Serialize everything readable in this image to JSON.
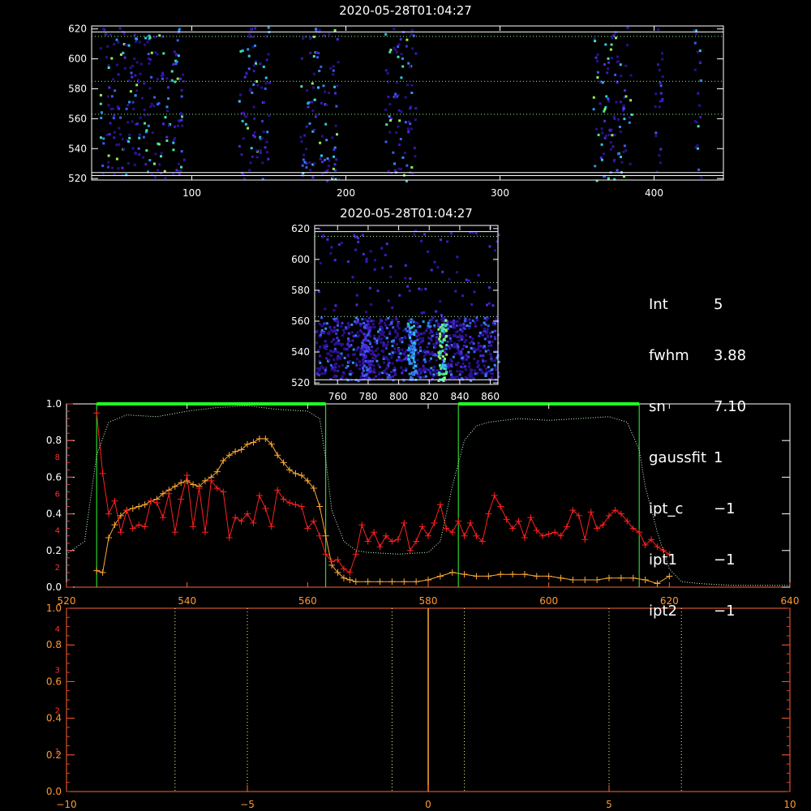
{
  "panel1": {
    "title": "2020-05-28T01:04:27",
    "x_ticks": [
      "100",
      "200",
      "300",
      "400"
    ],
    "y_ticks": [
      "520",
      "540",
      "560",
      "580",
      "600",
      "620"
    ]
  },
  "panel2": {
    "title": "2020-05-28T01:04:27",
    "x_ticks": [
      "760",
      "780",
      "800",
      "820",
      "840",
      "860"
    ],
    "y_ticks": [
      "520",
      "540",
      "560",
      "580",
      "600",
      "620"
    ]
  },
  "info": [
    {
      "key": "Int",
      "value": "5"
    },
    {
      "key": "fwhm",
      "value": "3.88"
    },
    {
      "key": "sn",
      "value": "7.10"
    },
    {
      "key": "gaussfit",
      "value": "1"
    },
    {
      "key": "ipt_c",
      "value": "−1"
    },
    {
      "key": "ipt1",
      "value": "−1"
    },
    {
      "key": "ipt2",
      "value": "−1"
    }
  ],
  "panel3": {
    "x_ticks": [
      "520",
      "540",
      "560",
      "580",
      "600",
      "620",
      "640"
    ],
    "y_ticks": [
      "0.0",
      "0.2",
      "0.4",
      "0.6",
      "0.8",
      "1.0"
    ],
    "y2_ticks": [
      "2",
      "4",
      "6",
      "8"
    ]
  },
  "panel4": {
    "x_ticks": [
      "−10",
      "−5",
      "0",
      "5",
      "10"
    ],
    "y_ticks": [
      "0.0",
      "0.2",
      "0.4",
      "0.6",
      "0.8",
      "1.0"
    ],
    "y2_ticks": [
      "1",
      "2",
      "3",
      "4"
    ]
  },
  "chart_data": [
    {
      "type": "heatmap",
      "title": "2020-05-28T01:04:27",
      "xlim": [
        35,
        445
      ],
      "ylim": [
        519,
        622
      ],
      "bands_x": [
        [
          40,
          95
        ],
        [
          130,
          150
        ],
        [
          170,
          195
        ],
        [
          225,
          245
        ],
        [
          360,
          385
        ],
        [
          400,
          405
        ],
        [
          425,
          430
        ]
      ],
      "hlines_y": [
        524,
        563,
        585,
        615
      ]
    },
    {
      "type": "heatmap",
      "title": "2020-05-28T01:04:27",
      "xlim": [
        745,
        865
      ],
      "ylim": [
        519,
        622
      ],
      "hlines_y": [
        563,
        585,
        615
      ]
    },
    {
      "type": "line",
      "xlim": [
        520,
        640
      ],
      "ylim": [
        0,
        1.0
      ],
      "boxes": [
        {
          "x0": 525,
          "x1": 563,
          "y": 1.0
        },
        {
          "x0": 585,
          "x1": 615,
          "y": 1.0
        }
      ],
      "series": [
        {
          "color": "#ffaa33",
          "x": [
            525,
            526,
            527,
            528,
            529,
            530,
            531,
            532,
            533,
            534,
            535,
            536,
            537,
            538,
            539,
            540,
            541,
            542,
            543,
            544,
            545,
            546,
            547,
            548,
            549,
            550,
            551,
            552,
            553,
            554,
            555,
            556,
            557,
            558,
            559,
            560,
            561,
            562,
            563,
            564,
            565,
            566,
            567,
            568,
            570,
            572,
            574,
            576,
            578,
            580,
            582,
            584,
            586,
            588,
            590,
            592,
            594,
            596,
            598,
            600,
            602,
            604,
            606,
            608,
            610,
            612,
            614,
            616,
            618,
            620
          ],
          "y": [
            0.09,
            0.08,
            0.27,
            0.34,
            0.39,
            0.42,
            0.43,
            0.44,
            0.45,
            0.47,
            0.48,
            0.51,
            0.53,
            0.55,
            0.57,
            0.58,
            0.56,
            0.55,
            0.58,
            0.6,
            0.63,
            0.69,
            0.72,
            0.74,
            0.75,
            0.78,
            0.79,
            0.81,
            0.81,
            0.78,
            0.72,
            0.68,
            0.64,
            0.62,
            0.61,
            0.58,
            0.54,
            0.44,
            0.28,
            0.12,
            0.08,
            0.05,
            0.04,
            0.03,
            0.03,
            0.03,
            0.03,
            0.03,
            0.03,
            0.04,
            0.06,
            0.08,
            0.07,
            0.06,
            0.06,
            0.07,
            0.07,
            0.07,
            0.06,
            0.06,
            0.05,
            0.04,
            0.04,
            0.04,
            0.05,
            0.05,
            0.05,
            0.04,
            0.02,
            0.06
          ]
        },
        {
          "color": "#ff2020",
          "x": [
            525,
            526,
            527,
            528,
            529,
            530,
            531,
            532,
            533,
            534,
            535,
            536,
            537,
            538,
            539,
            540,
            541,
            542,
            543,
            544,
            545,
            546,
            547,
            548,
            549,
            550,
            551,
            552,
            553,
            554,
            555,
            556,
            557,
            558,
            559,
            560,
            561,
            562,
            563,
            564,
            565,
            566,
            567,
            568,
            569,
            570,
            571,
            572,
            573,
            574,
            575,
            576,
            577,
            578,
            579,
            580,
            581,
            582,
            583,
            584,
            585,
            586,
            587,
            588,
            589,
            590,
            591,
            592,
            593,
            594,
            595,
            596,
            597,
            598,
            599,
            600,
            601,
            602,
            603,
            604,
            605,
            606,
            607,
            608,
            609,
            610,
            611,
            612,
            613,
            614,
            615,
            616,
            617,
            618,
            619,
            620
          ],
          "y": [
            0.95,
            0.62,
            0.4,
            0.47,
            0.3,
            0.42,
            0.32,
            0.34,
            0.33,
            0.47,
            0.46,
            0.38,
            0.51,
            0.3,
            0.48,
            0.61,
            0.33,
            0.54,
            0.3,
            0.58,
            0.54,
            0.52,
            0.27,
            0.38,
            0.36,
            0.4,
            0.35,
            0.5,
            0.43,
            0.33,
            0.53,
            0.48,
            0.46,
            0.45,
            0.44,
            0.32,
            0.36,
            0.28,
            0.18,
            0.14,
            0.15,
            0.1,
            0.08,
            0.18,
            0.34,
            0.25,
            0.3,
            0.22,
            0.28,
            0.25,
            0.26,
            0.35,
            0.2,
            0.25,
            0.33,
            0.28,
            0.35,
            0.45,
            0.32,
            0.3,
            0.36,
            0.28,
            0.35,
            0.28,
            0.25,
            0.4,
            0.5,
            0.44,
            0.37,
            0.32,
            0.36,
            0.27,
            0.38,
            0.31,
            0.28,
            0.29,
            0.3,
            0.28,
            0.33,
            0.42,
            0.39,
            0.26,
            0.41,
            0.32,
            0.34,
            0.39,
            0.42,
            0.4,
            0.36,
            0.32,
            0.3,
            0.23,
            0.26,
            0.22,
            0.2,
            0.18
          ]
        },
        {
          "color": "#ccffcc",
          "x": [
            520,
            523,
            525,
            527,
            530,
            535,
            540,
            545,
            550,
            555,
            560,
            562,
            563,
            564,
            566,
            568,
            570,
            575,
            580,
            582,
            584,
            586,
            588,
            590,
            595,
            600,
            605,
            610,
            613,
            615,
            616,
            618,
            620,
            622,
            625,
            630,
            635,
            640
          ],
          "y": [
            0.18,
            0.25,
            0.72,
            0.9,
            0.94,
            0.93,
            0.96,
            0.98,
            0.99,
            0.97,
            0.96,
            0.92,
            0.7,
            0.42,
            0.25,
            0.2,
            0.19,
            0.18,
            0.19,
            0.25,
            0.55,
            0.8,
            0.88,
            0.9,
            0.92,
            0.91,
            0.92,
            0.93,
            0.9,
            0.75,
            0.55,
            0.3,
            0.1,
            0.03,
            0.02,
            0.01,
            0.01,
            0.01
          ]
        }
      ]
    },
    {
      "type": "line",
      "xlim": [
        -10,
        10
      ],
      "ylim": [
        0,
        1.0
      ],
      "dotted_x": [
        -7,
        -5,
        -1,
        1,
        5,
        7
      ],
      "center_x": 0
    }
  ]
}
